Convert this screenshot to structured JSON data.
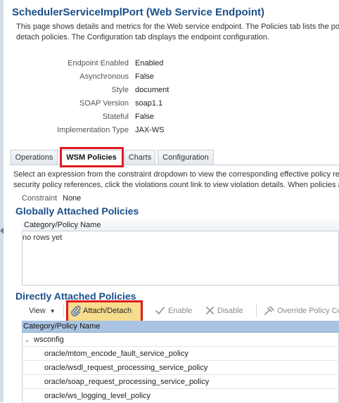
{
  "page": {
    "title": "SchedulerServiceImplPort (Web Service Endpoint)",
    "description_line1": "This page shows details and metrics for the Web service endpoint. The Policies tab lists the polic",
    "description_line2": "detach policies. The Configuration tab displays the endpoint configuration."
  },
  "properties": [
    {
      "label": "Endpoint Enabled",
      "value": "Enabled"
    },
    {
      "label": "Asynchronous",
      "value": "False"
    },
    {
      "label": "Style",
      "value": "document"
    },
    {
      "label": "SOAP Version",
      "value": "soap1.1"
    },
    {
      "label": "Stateful",
      "value": "False"
    },
    {
      "label": "Implementation Type",
      "value": "JAX-WS"
    }
  ],
  "tabs": [
    {
      "label": "Operations"
    },
    {
      "label": "WSM Policies",
      "active": true
    },
    {
      "label": "Charts"
    },
    {
      "label": "Configuration"
    }
  ],
  "policies_tab": {
    "description_line1": "Select an expression from the constraint dropdown to view the corresponding effective policy re",
    "description_line2": "security policy references, click the violations count link to view violation details. When policies ar",
    "constraint_label": "Constraint",
    "constraint_value": "None"
  },
  "global_section": {
    "title": "Globally Attached Policies",
    "column_header": "Category/Policy Name",
    "empty_text": "no rows yet"
  },
  "direct_section": {
    "title": "Directly Attached Policies",
    "toolbar": {
      "view_label": "View",
      "attach_label": "Attach/Detach",
      "enable_label": "Enable",
      "disable_label": "Disable",
      "override_label": "Override Policy Co"
    },
    "column_header": "Category/Policy Name",
    "group": "wsconfig",
    "rows": [
      "oracle/mtom_encode_fault_service_policy",
      "oracle/wsdl_request_processing_service_policy",
      "oracle/soap_request_processing_service_policy",
      "oracle/ws_logging_level_policy"
    ]
  },
  "colors": {
    "title_blue": "#1b4f8a",
    "highlight_red": "#e01a22",
    "table_header_selected": "#a9c3e3",
    "attach_button_bg": "#f6dc8c"
  }
}
